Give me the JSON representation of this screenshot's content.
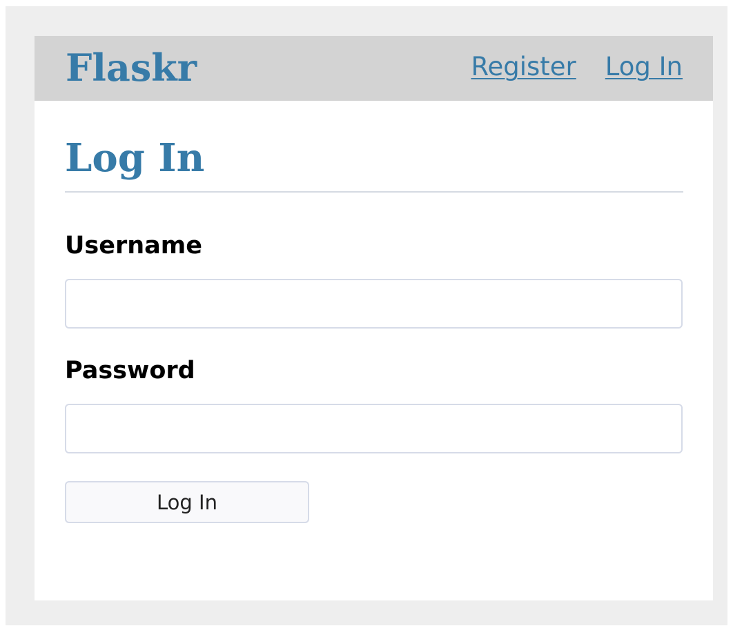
{
  "header": {
    "brand": "Flaskr",
    "nav": {
      "register_label": "Register",
      "login_label": "Log In"
    }
  },
  "main": {
    "title": "Log In",
    "form": {
      "username_label": "Username",
      "username_value": "",
      "password_label": "Password",
      "password_value": "",
      "submit_label": "Log In"
    }
  },
  "colors": {
    "accent": "#377ba8",
    "nav_background": "#d3d3d3",
    "page_background": "#eeeeee"
  }
}
